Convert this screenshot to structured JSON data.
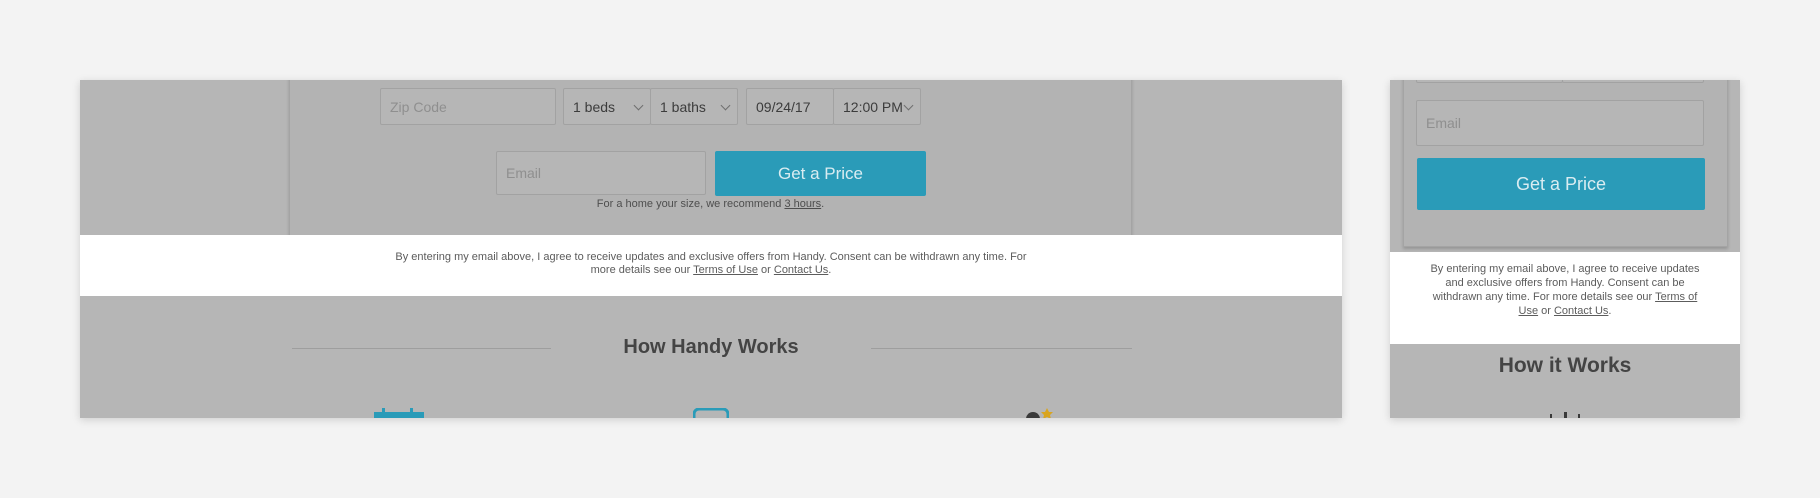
{
  "form": {
    "zip_placeholder": "Zip Code",
    "beds_value": "1 beds",
    "baths_value": "1 baths",
    "date_value": "09/24/17",
    "time_value": "12:00 PM",
    "email_placeholder": "Email",
    "submit_label": "Get a Price",
    "recommend_prefix": "For a home your size, we recommend ",
    "recommend_link": "3 hours",
    "recommend_suffix": "."
  },
  "consent": {
    "text": "By entering my email above, I agree to receive updates and exclusive offers from Handy. Consent can be withdrawn any time. For more details see our ",
    "terms_link": "Terms of Use",
    "or_text": " or ",
    "contact_link": "Contact Us",
    "end": "."
  },
  "desktop": {
    "section_title": "How Handy Works"
  },
  "mobile": {
    "section_title": "How it Works"
  },
  "colors": {
    "accent": "#2a9bb8",
    "overlay": "#b6b6b6",
    "page_bg": "#f3f3f3"
  },
  "icons": [
    "calendar-icon",
    "phone-icon",
    "star-cleaner-icon"
  ]
}
